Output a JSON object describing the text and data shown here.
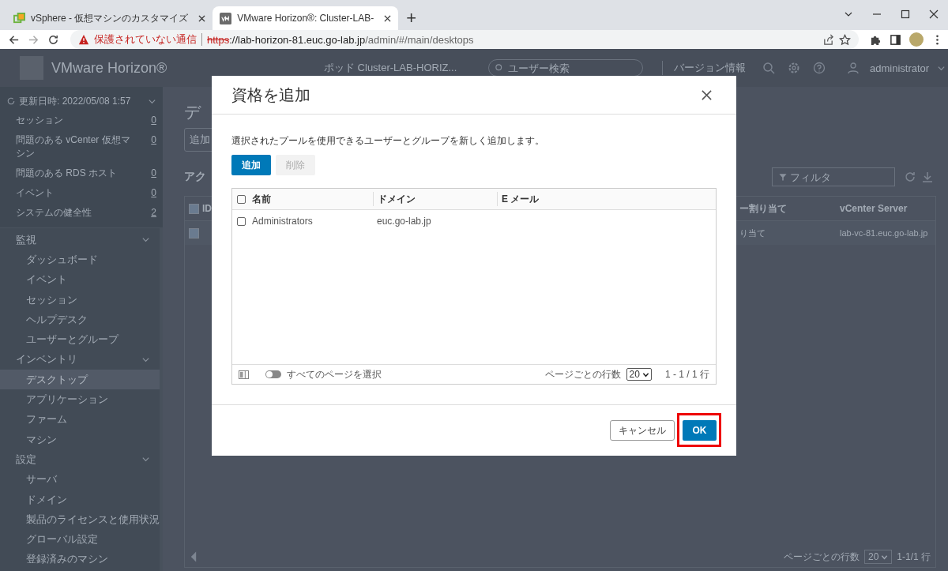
{
  "browser": {
    "tabs": [
      {
        "title": "vSphere - 仮想マシンのカスタマイズ",
        "kind": "vsphere",
        "selected": false
      },
      {
        "title": "VMware Horizon®: Cluster-LAB-",
        "kind": "vm",
        "selected": true
      }
    ],
    "new_tab": "+",
    "security_warning": "保護されていない通信",
    "url": {
      "scheme": "https",
      "host": "://lab-horizon-81.euc.go-lab.jp",
      "path": "/admin/#/main/desktops"
    }
  },
  "header": {
    "logo": "VMware Horizon®",
    "pod": "ポッド Cluster-LAB-HORIZ...",
    "search": {
      "placeholder": "ユーザー検索"
    },
    "version_link": "バージョン情報",
    "user": "administrator"
  },
  "status_panel": {
    "updated": "更新日時: 2022/05/08 1:57",
    "items": [
      {
        "label": "セッション",
        "count": "0"
      },
      {
        "label": "問題のある vCenter 仮想マシン",
        "count": "0"
      },
      {
        "label": "問題のある RDS ホスト",
        "count": "0"
      },
      {
        "label": "イベント",
        "count": "0"
      },
      {
        "label": "システムの健全性",
        "count": "2"
      }
    ]
  },
  "nav": [
    {
      "label": "監視",
      "expanded": true,
      "children": [
        {
          "label": "ダッシュボード",
          "selected": false
        },
        {
          "label": "イベント",
          "selected": false
        },
        {
          "label": "セッション",
          "selected": false
        },
        {
          "label": "ヘルプデスク",
          "selected": false
        },
        {
          "label": "ユーザーとグループ",
          "selected": false
        }
      ]
    },
    {
      "label": "インベントリ",
      "expanded": true,
      "children": [
        {
          "label": "デスクトップ",
          "selected": true
        },
        {
          "label": "アプリケーション",
          "selected": false
        },
        {
          "label": "ファーム",
          "selected": false
        },
        {
          "label": "マシン",
          "selected": false
        }
      ]
    },
    {
      "label": "設定",
      "expanded": true,
      "children": [
        {
          "label": "サーバ",
          "selected": false
        },
        {
          "label": "ドメイン",
          "selected": false
        },
        {
          "label": "製品のライセンスと使用状況",
          "selected": false
        },
        {
          "label": "グローバル設定",
          "selected": false
        },
        {
          "label": "登録済みのマシン",
          "selected": false
        }
      ]
    }
  ],
  "page": {
    "title": "デ",
    "add_button": "追加",
    "section": "アク",
    "filter": {
      "placeholder": "フィルタ"
    },
    "table": {
      "header_checked": true,
      "columns": [
        "ID",
        "ー割り当て",
        "vCenter Server"
      ],
      "rows": [
        {
          "checked": true,
          "assignment": "り当て",
          "vcenter": "lab-vc-81.euc.go-lab.jp"
        }
      ]
    },
    "pager": {
      "rows_label": "ページごとの行数",
      "rows_per_page": "20",
      "range": "1-1/1 行"
    }
  },
  "dialog": {
    "title": "資格を追加",
    "description": "選択されたプールを使用できるユーザーとグループを新しく追加します。",
    "add_button": {
      "label": "追加",
      "disabled": false
    },
    "remove_button": {
      "label": "削除",
      "disabled": true
    },
    "table": {
      "header_checked": false,
      "columns": [
        "名前",
        "ドメイン",
        "E メール"
      ],
      "rows": [
        {
          "checked": false,
          "name": "Administrators",
          "domain": "euc.go-lab.jp"
        }
      ],
      "select_all_pages": {
        "label": "すべてのページを選択",
        "on": false
      },
      "rows_label": "ページごとの行数",
      "rows_per_page": "20",
      "range": "1 - 1 / 1 行"
    },
    "cancel_button": "キャンセル",
    "ok_button": {
      "label": "OK",
      "highlighted": true
    }
  }
}
